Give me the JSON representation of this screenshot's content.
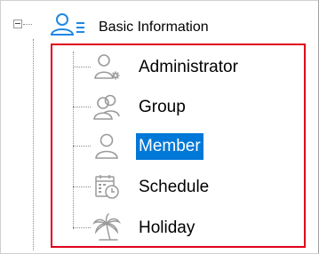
{
  "tree": {
    "root": {
      "label": "Basic Information",
      "icon": "user-list-icon",
      "expanded": true
    },
    "children": [
      {
        "label": "Administrator",
        "icon": "admin-user-gear-icon",
        "selected": false
      },
      {
        "label": "Group",
        "icon": "user-group-icon",
        "selected": false
      },
      {
        "label": "Member",
        "icon": "member-user-icon",
        "selected": true
      },
      {
        "label": "Schedule",
        "icon": "calendar-clock-icon",
        "selected": false
      },
      {
        "label": "Holiday",
        "icon": "palm-tree-icon",
        "selected": false
      }
    ]
  },
  "colors": {
    "selection": "#0078d7",
    "highlight_border": "#e0001a",
    "root_icon": "#1e88e5",
    "icon_gray": "#9a9a9a"
  }
}
